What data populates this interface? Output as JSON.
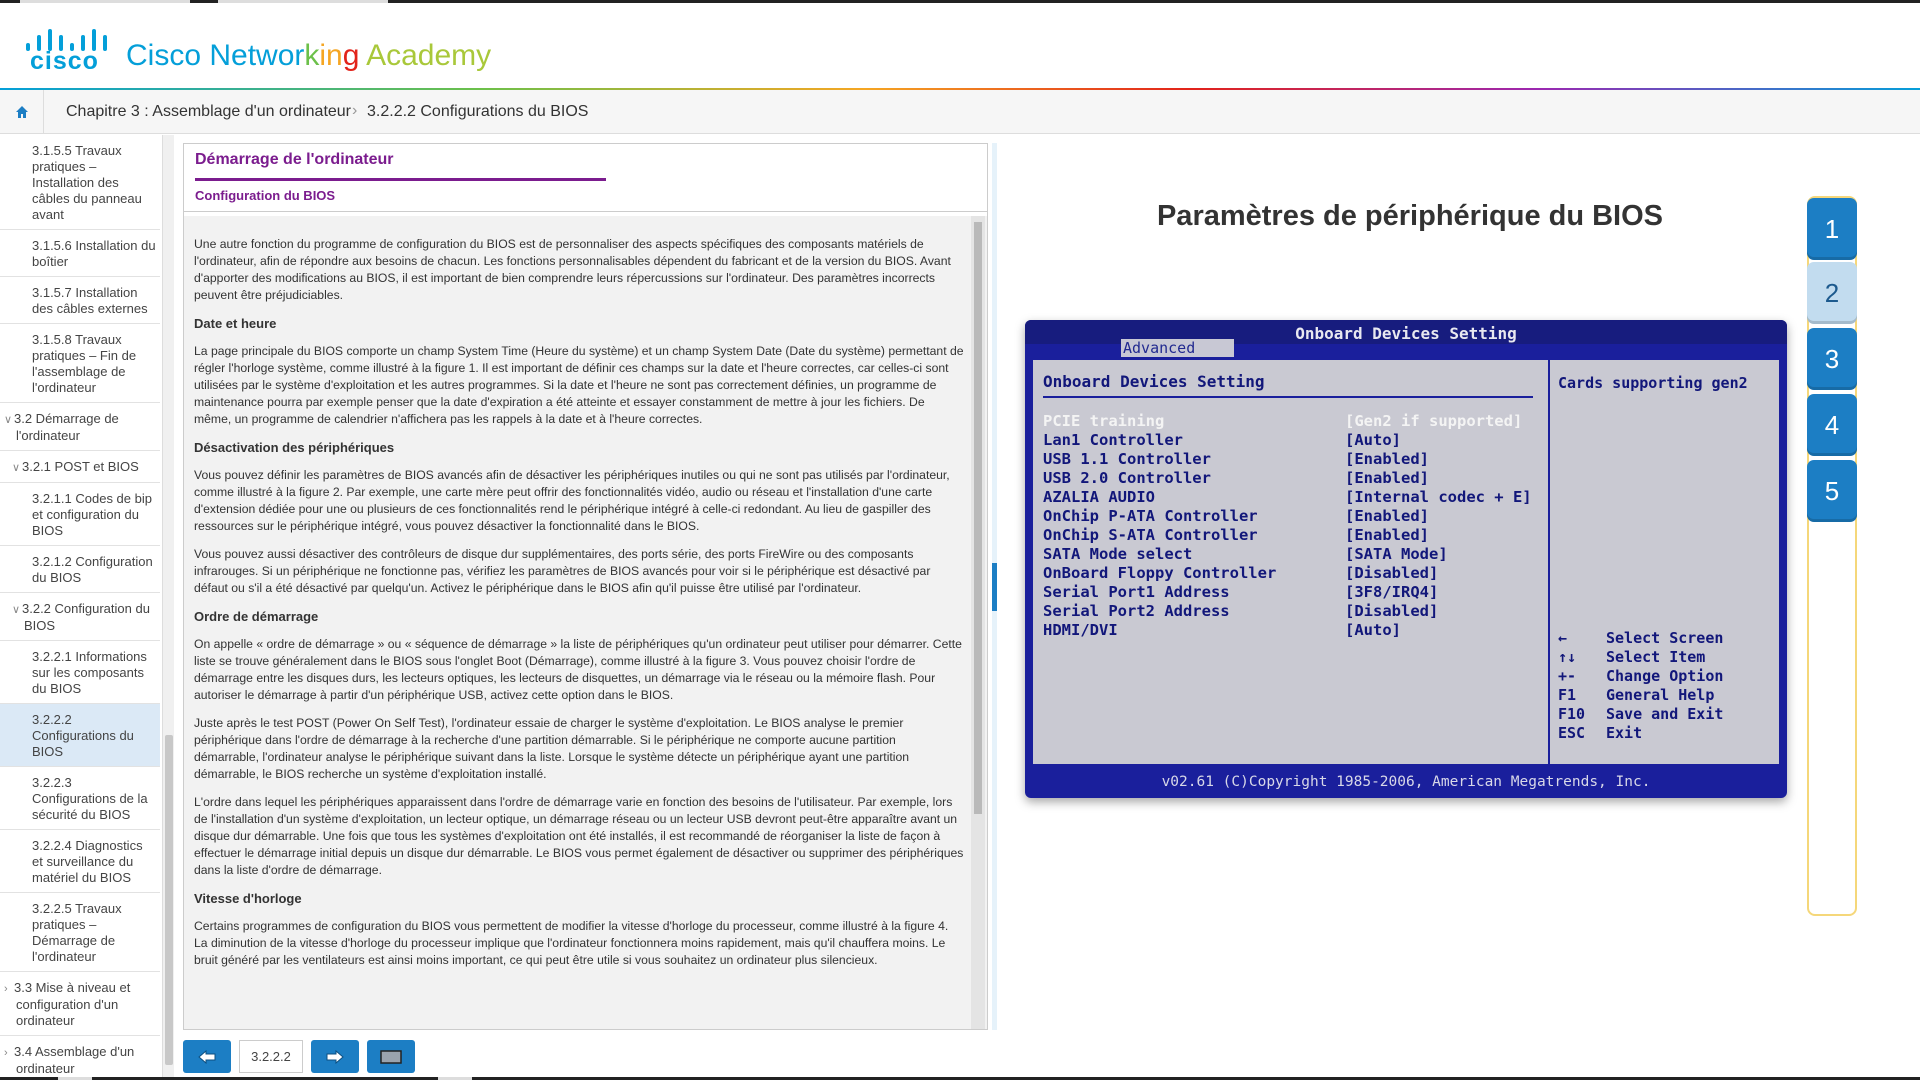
{
  "header": {
    "logo_text": "cisco",
    "brand_parts": [
      {
        "text": "Cisco ",
        "color": "#049fd9"
      },
      {
        "text": "Networ",
        "color": "#049fd9"
      },
      {
        "text": "k",
        "color": "#6cc04a"
      },
      {
        "text": "in",
        "color": "#f5a623"
      },
      {
        "text": "g",
        "color": "#e2231a"
      },
      {
        "text": " Academy",
        "color": "#a9c83a"
      }
    ]
  },
  "breadcrumb": {
    "home_icon": "home-icon",
    "items": [
      "Chapitre 3 : Assemblage d'un ordinateur",
      "3.2.2.2 Configurations du BIOS"
    ],
    "separator": "›"
  },
  "sidebar": {
    "items": [
      {
        "label": "3.1.5.5 Travaux pratiques – Installation des câbles du panneau avant",
        "level": 3,
        "chevron": ""
      },
      {
        "label": "3.1.5.6 Installation du boîtier",
        "level": 3,
        "chevron": ""
      },
      {
        "label": "3.1.5.7 Installation des câbles externes",
        "level": 3,
        "chevron": ""
      },
      {
        "label": "3.1.5.8 Travaux pratiques – Fin de l'assemblage de l'ordinateur",
        "level": 3,
        "chevron": ""
      },
      {
        "label": "3.2 Démarrage de l'ordinateur",
        "level": 1,
        "chevron": "∨"
      },
      {
        "label": "3.2.1 POST et BIOS",
        "level": 2,
        "chevron": "∨"
      },
      {
        "label": "3.2.1.1 Codes de bip et configuration du BIOS",
        "level": 3,
        "chevron": ""
      },
      {
        "label": "3.2.1.2 Configuration du BIOS",
        "level": 3,
        "chevron": ""
      },
      {
        "label": "3.2.2 Configuration du BIOS",
        "level": 2,
        "chevron": "∨"
      },
      {
        "label": "3.2.2.1 Informations sur les composants du BIOS",
        "level": 3,
        "chevron": ""
      },
      {
        "label": "3.2.2.2 Configurations du BIOS",
        "level": 3,
        "chevron": "",
        "active": true
      },
      {
        "label": "3.2.2.3 Configurations de la sécurité du BIOS",
        "level": 3,
        "chevron": ""
      },
      {
        "label": "3.2.2.4 Diagnostics et surveillance du matériel du BIOS",
        "level": 3,
        "chevron": ""
      },
      {
        "label": "3.2.2.5 Travaux pratiques – Démarrage de l'ordinateur",
        "level": 3,
        "chevron": ""
      },
      {
        "label": "3.3 Mise à niveau et configuration d'un ordinateur",
        "level": 1,
        "chevron": "›"
      },
      {
        "label": "3.4 Assemblage d'un ordinateur",
        "level": 1,
        "chevron": "›"
      }
    ]
  },
  "panel": {
    "title": "Démarrage de l'ordinateur",
    "subtitle": "Configuration du BIOS",
    "blocks": [
      {
        "type": "p",
        "text": "Une autre fonction du programme de configuration du BIOS est de personnaliser des aspects spécifiques des composants matériels de l'ordinateur, afin de répondre aux besoins de chacun. Les fonctions personnalisables dépendent du fabricant et de la version du BIOS. Avant d'apporter des modifications au BIOS, il est important de bien comprendre leurs répercussions sur l'ordinateur. Des paramètres incorrects peuvent être préjudiciables."
      },
      {
        "type": "h",
        "text": "Date et heure"
      },
      {
        "type": "p",
        "text": "La page principale du BIOS comporte un champ System Time (Heure du système) et un champ System Date (Date du système) permettant de régler l'horloge système, comme illustré à la figure 1. Il est important de définir ces champs sur la date et l'heure correctes, car celles-ci sont utilisées par le système d'exploitation et les autres programmes. Si la date et l'heure ne sont pas correctement définies, un programme de maintenance pourra par exemple penser que la date d'expiration a été atteinte et essayer constamment de mettre à jour les fichiers. De même, un programme de calendrier n'affichera pas les rappels à la date et à l'heure correctes."
      },
      {
        "type": "h",
        "text": "Désactivation des périphériques"
      },
      {
        "type": "p",
        "text": "Vous pouvez définir les paramètres de BIOS avancés afin de désactiver les périphériques inutiles ou qui ne sont pas utilisés par l'ordinateur, comme illustré à la figure 2. Par exemple, une carte mère peut offrir des fonctionnalités vidéo, audio ou réseau et l'installation d'une carte d'extension dédiée pour une ou plusieurs de ces fonctionnalités rend le périphérique intégré à celle-ci redondant. Au lieu de gaspiller des ressources sur le périphérique intégré, vous pouvez désactiver la fonctionnalité dans le BIOS."
      },
      {
        "type": "p",
        "text": "Vous pouvez aussi désactiver des contrôleurs de disque dur supplémentaires, des ports série, des ports FireWire ou des composants infrarouges. Si un périphérique ne fonctionne pas, vérifiez les paramètres de BIOS avancés pour voir si le périphérique est désactivé par défaut ou s'il a été désactivé par quelqu'un. Activez le périphérique dans le BIOS afin qu'il puisse être utilisé par l'ordinateur."
      },
      {
        "type": "h",
        "text": "Ordre de démarrage"
      },
      {
        "type": "p",
        "text": "On appelle « ordre de démarrage » ou « séquence de démarrage » la liste de périphériques qu'un ordinateur peut utiliser pour démarrer. Cette liste se trouve généralement dans le BIOS sous l'onglet Boot (Démarrage), comme illustré à la figure 3. Vous pouvez choisir l'ordre de démarrage entre les disques durs, les lecteurs optiques, les lecteurs de disquettes, un démarrage via le réseau ou la mémoire flash. Pour autoriser le démarrage à partir d'un périphérique USB, activez cette option dans le BIOS."
      },
      {
        "type": "p",
        "text": "Juste après le test POST (Power On Self Test), l'ordinateur essaie de charger le système d'exploitation. Le BIOS analyse le premier périphérique dans l'ordre de démarrage à la recherche d'une partition démarrable. Si le périphérique ne comporte aucune partition démarrable, l'ordinateur analyse le périphérique suivant dans la liste. Lorsque le système détecte un périphérique ayant une partition démarrable, le BIOS recherche un système d'exploitation installé."
      },
      {
        "type": "p",
        "text": "L'ordre dans lequel les périphériques apparaissent dans l'ordre de démarrage varie en fonction des besoins de l'utilisateur. Par exemple, lors de l'installation d'un système d'exploitation, un lecteur optique, un démarrage réseau ou un lecteur USB devront peut-être apparaître avant un disque dur démarrable. Une fois que tous les systèmes d'exploitation ont été installés, il est recommandé de réorganiser la liste de façon à effectuer le démarrage initial depuis un disque dur démarrable. Le BIOS vous permet également de désactiver ou supprimer des périphériques dans la liste d'ordre de démarrage."
      },
      {
        "type": "h",
        "text": "Vitesse d'horloge"
      },
      {
        "type": "p",
        "text": "Certains programmes de configuration du BIOS vous permettent de modifier la vitesse d'horloge du processeur, comme illustré à la figure 4. La diminution de la vitesse d'horloge du processeur implique que l'ordinateur fonctionnera moins rapidement, mais qu'il chauffera moins. Le bruit généré par les ventilateurs est ainsi moins important, ce qui peut être utile si vous souhaitez un ordinateur plus silencieux."
      }
    ]
  },
  "bottom_nav": {
    "prev_icon": "arrow-left-icon",
    "page_label": "3.2.2.2",
    "next_icon": "arrow-right-icon",
    "media_icon": "screen-icon"
  },
  "figure": {
    "title": "Paramètres de périphérique du BIOS",
    "bios": {
      "window_title": "Onboard Devices Setting",
      "tab": "Advanced",
      "section": "Onboard Devices Setting",
      "rows": [
        {
          "label": "PCIE training",
          "value": "[Gen2 if supported]",
          "highlight": true
        },
        {
          "label": "Lan1 Controller",
          "value": "[Auto]"
        },
        {
          "label": "USB 1.1 Controller",
          "value": "[Enabled]"
        },
        {
          "label": "USB 2.0 Controller",
          "value": "[Enabled]"
        },
        {
          "label": "AZALIA AUDIO",
          "value": "[Internal codec + E]"
        },
        {
          "label": "OnChip P-ATA Controller",
          "value": "[Enabled]"
        },
        {
          "label": "OnChip S-ATA Controller",
          "value": "[Enabled]"
        },
        {
          "label": "SATA Mode select",
          "value": "[SATA Mode]"
        },
        {
          "label": "OnBoard Floppy Controller",
          "value": "[Disabled]"
        },
        {
          "label": "Serial Port1 Address",
          "value": "[3F8/IRQ4]"
        },
        {
          "label": "Serial Port2 Address",
          "value": "[Disabled]"
        },
        {
          "label": "HDMI/DVI",
          "value": "[Auto]"
        }
      ],
      "help_text": "Cards supporting gen2",
      "keys": [
        {
          "key": "←",
          "desc": "Select Screen"
        },
        {
          "key": "↑↓",
          "desc": " Select Item"
        },
        {
          "key": "+-",
          "desc": " Change Option"
        },
        {
          "key": "F1",
          "desc": " General Help"
        },
        {
          "key": "F10",
          "desc": " Save and Exit"
        },
        {
          "key": "ESC",
          "desc": " Exit"
        }
      ],
      "footer": "v02.61 (C)Copyright 1985-2006, American Megatrends, Inc."
    },
    "selector": [
      "1",
      "2",
      "3",
      "4",
      "5"
    ],
    "selected": "2"
  },
  "colors": {
    "accent": "#1c7ec4",
    "cisco_blue": "#049fd9",
    "title_purple": "#7b1c8e",
    "bios_blue": "#1a1f9c",
    "bios_grey": "#c9c9d2"
  }
}
